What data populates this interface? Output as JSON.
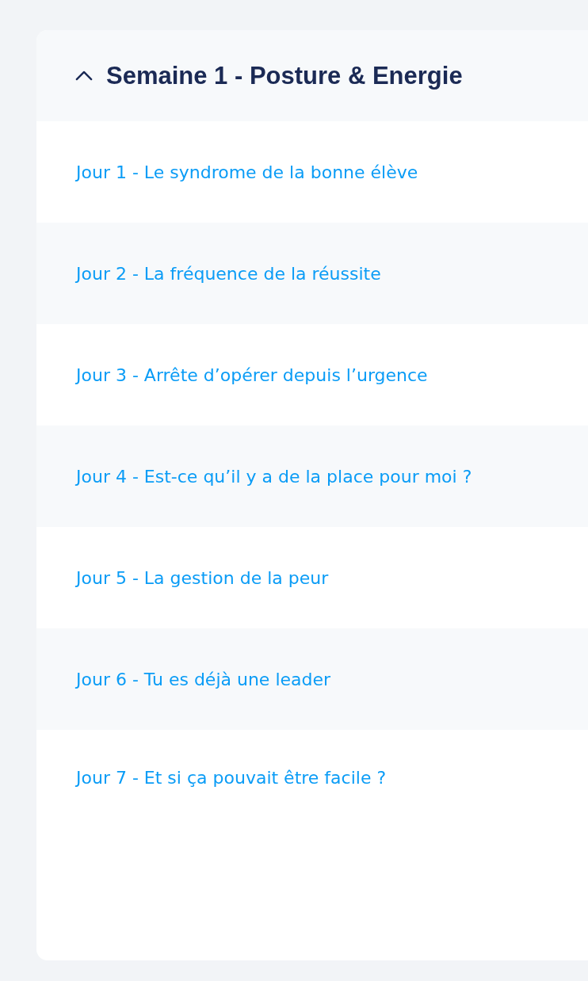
{
  "section": {
    "title": "Semaine 1 - Posture & Energie",
    "expanded": true,
    "lessons": [
      {
        "label": "Jour 1 - Le syndrome de la bonne élève"
      },
      {
        "label": "Jour 2 - La fréquence de la réussite"
      },
      {
        "label": "Jour 3 - Arrête d’opérer depuis l’urgence"
      },
      {
        "label": "Jour 4 - Est-ce qu’il y a de la place pour moi ?"
      },
      {
        "label": "Jour 5 - La gestion de la peur"
      },
      {
        "label": "Jour 6 - Tu es déjà une leader"
      },
      {
        "label": "Jour 7 - Et si ça pouvait être facile ?"
      }
    ]
  }
}
